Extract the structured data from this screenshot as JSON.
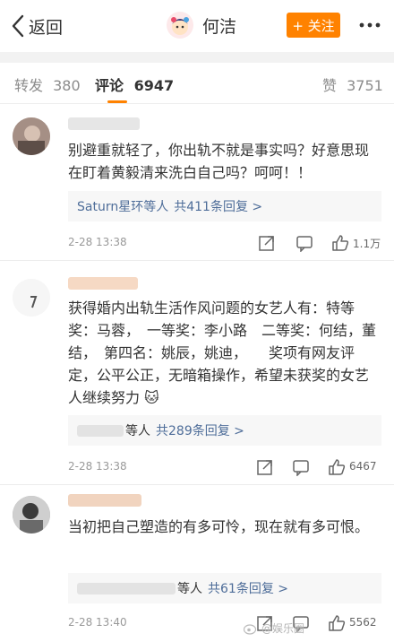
{
  "nav": {
    "back_label": "返回",
    "title": "何洁",
    "follow_label": "+ 关注"
  },
  "tabs": [
    {
      "label": "转发",
      "count": "380"
    },
    {
      "label": "评论",
      "count": "6947"
    },
    {
      "label": "赞",
      "count": "3751"
    }
  ],
  "comments": [
    {
      "text": "别避重就轻了，你出轨不就是事实吗？好意思现在盯着黄毅清来洗白自己吗？呵呵！！",
      "reply_name": "Saturn星环等人",
      "reply_link": "共411条回复 >",
      "time": "2-28 13:38",
      "likes": "1.1万"
    },
    {
      "text": "获得婚内出轨生活作风问题的女艺人有：特等奖：马蓉，　一等奖：李小路　二等奖：何结，董结，　第四名：姚辰，姚迪，　　奖项有网友评定，公平公正，无暗箱操作，希望未获奖的女艺人继续努力",
      "emoji": "🐱",
      "reply_name": "等人",
      "reply_link": "共289条回复 >",
      "time": "2-28 13:38",
      "likes": "6467"
    },
    {
      "text": "当初把自己塑造的有多可怜，现在就有多可恨。",
      "reply_name": "等人",
      "reply_link": "共61条回复 >",
      "time": "2-28 13:40",
      "likes": "5562"
    }
  ],
  "watermark": "@娱乐圈"
}
